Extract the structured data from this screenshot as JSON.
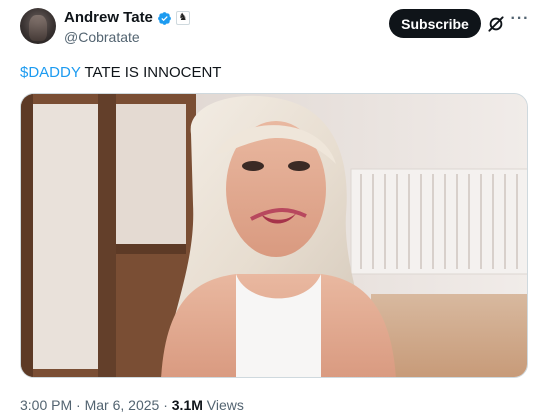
{
  "author": {
    "name": "Andrew Tate",
    "handle": "@Cobratate",
    "avatar_icon": "profile-photo",
    "verified_icon": "blue-verified-check",
    "affiliate_badge_icon": "chess-knight-badge",
    "affiliate_badge_glyph": "♞"
  },
  "actions": {
    "subscribe_label": "Subscribe",
    "grok_icon": "grok-icon",
    "more_label": "···"
  },
  "tweet": {
    "cashtag": "$DADDY",
    "text": " TATE IS INNOCENT"
  },
  "media": {
    "kind": "video-still",
    "description_icon": "video-thumbnail"
  },
  "meta": {
    "time": "3:00 PM",
    "separator1": " · ",
    "date": "Mar 6, 2025",
    "separator2": " · ",
    "views_count": "3.1M",
    "views_label": " Views"
  },
  "colors": {
    "accent": "#1d9bf0",
    "text_primary": "#0f1419",
    "text_secondary": "#536471",
    "button_bg": "#0f1419"
  }
}
